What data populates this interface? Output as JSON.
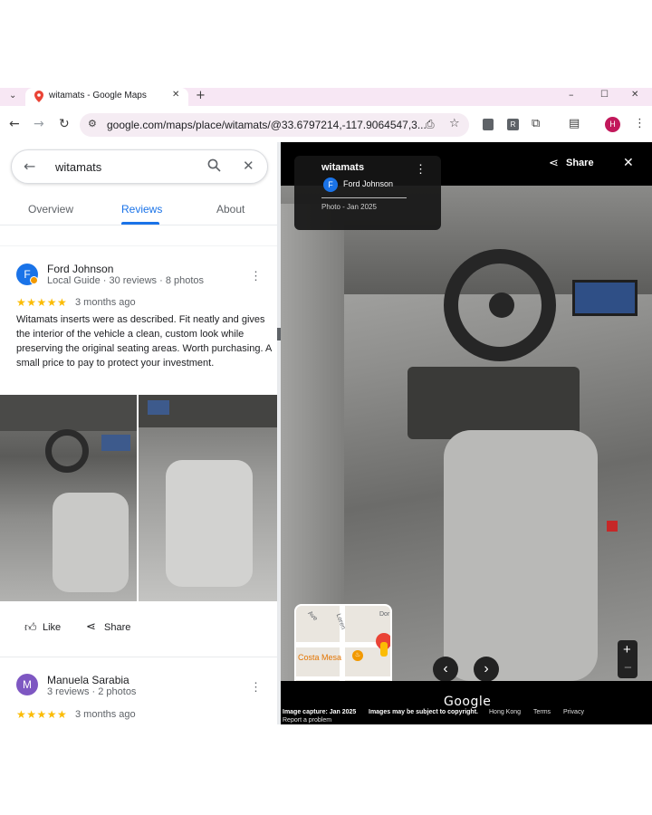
{
  "browser": {
    "tab_title": "witamats - Google Maps",
    "url": "google.com/maps/place/witamats/@33.6797214,-117.9064547,3...",
    "profile_initial": "H",
    "icons": [
      "tab-search-icon",
      "maps-favicon",
      "close-tab-icon",
      "new-tab-icon",
      "minimize-icon",
      "maximize-icon",
      "close-window-icon",
      "back-icon",
      "forward-icon",
      "reload-icon",
      "site-info-icon",
      "install-app-icon",
      "bookmark-star-icon",
      "extension-icon",
      "extension-r-icon",
      "extensions-puzzle-icon",
      "reading-list-icon",
      "profile-avatar"
    ]
  },
  "search": {
    "query": "witamats"
  },
  "tabs": [
    {
      "label": "Overview",
      "active": false
    },
    {
      "label": "Reviews",
      "active": true
    },
    {
      "label": "About",
      "active": false
    }
  ],
  "reviews": [
    {
      "avatar_initial": "F",
      "avatar_color": "#1a73e8",
      "name": "Ford Johnson",
      "meta": "Local Guide · 30 reviews · 8 photos",
      "stars": "★★★★★",
      "rating": 5,
      "time": "3 months ago",
      "text": "Witamats inserts were as described. Fit neatly and gives the interior of the vehicle a clean, custom look while preserving the original seating areas. Worth purchasing. A small price to pay to protect your investment.",
      "like_label": "Like",
      "share_label": "Share"
    },
    {
      "avatar_initial": "M",
      "avatar_color": "#7e57c2",
      "name": "Manuela Sarabia",
      "meta": "3 reviews · 2 photos",
      "stars": "★★★★★",
      "rating": 5,
      "time": "3 months ago"
    }
  ],
  "viewer": {
    "title": "witamats",
    "share_label": "Share",
    "contributor_initial": "F",
    "contributor": "Ford Johnson",
    "photo_date": "Photo - Jan 2025",
    "footer": {
      "capture": "Image capture: Jan 2025",
      "copyright": "Images may be subject to copyright.",
      "region": "Hong Kong",
      "terms": "Terms",
      "privacy": "Privacy",
      "report": "Report a problem",
      "logo": "Google"
    },
    "minimap": {
      "place": "Costa Mesa",
      "street1": "Ave",
      "street2": "Loren",
      "street3": "Dor"
    }
  },
  "colors": {
    "accent": "#1a73e8",
    "star": "#fbbc04",
    "tabbar": "#f7e7f4",
    "viewer_bg": "#000000"
  }
}
